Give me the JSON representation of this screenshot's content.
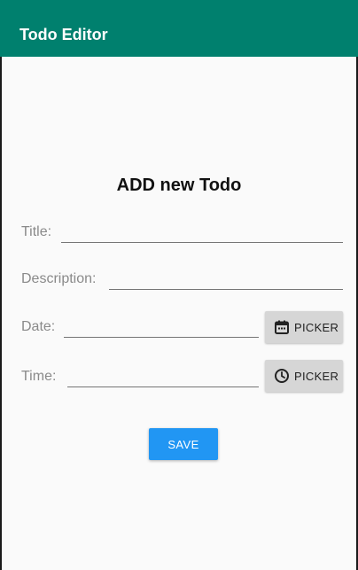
{
  "appbar": {
    "title": "Todo Editor",
    "color": "#00806e"
  },
  "form": {
    "heading": "ADD new Todo",
    "title_label": "Title:",
    "title_value": "",
    "description_label": "Description:",
    "description_value": "",
    "date_label": "Date:",
    "date_value": "",
    "time_label": "Time:",
    "time_value": ""
  },
  "buttons": {
    "date_picker_label": "PICKER",
    "date_picker_icon": "calendar-icon",
    "time_picker_label": "PICKER",
    "time_picker_icon": "clock-icon",
    "save_label": "SAVE",
    "save_color": "#2196f3"
  }
}
